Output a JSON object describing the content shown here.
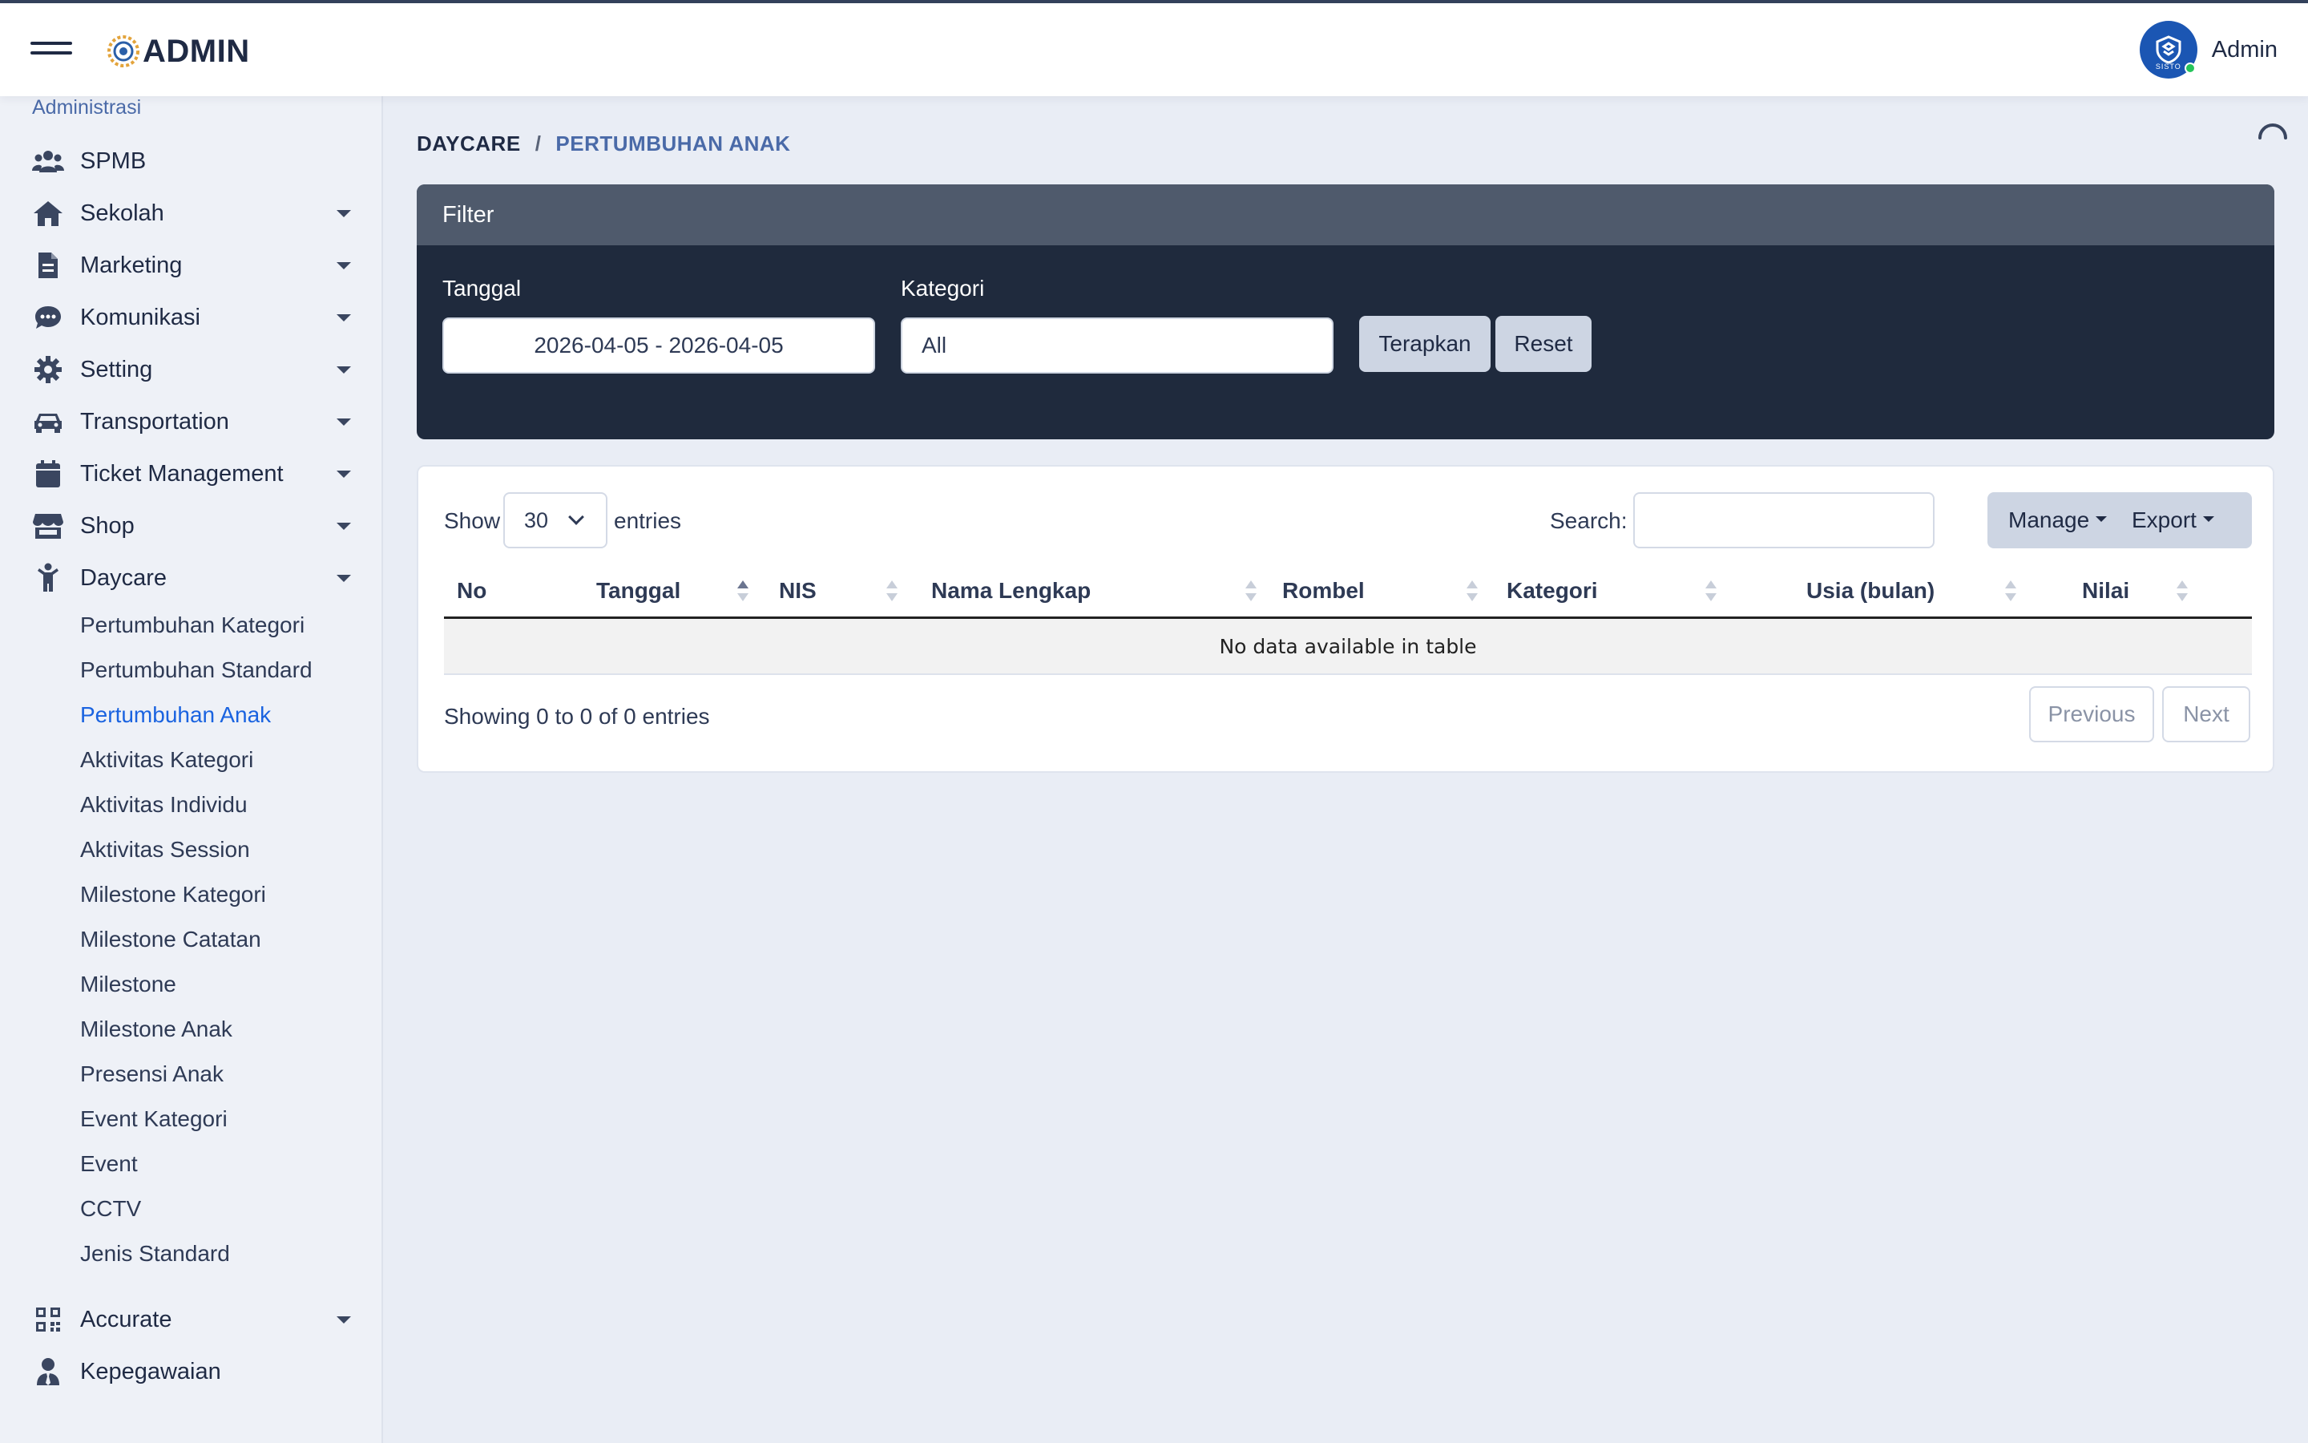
{
  "app": {
    "title": "ADMIN",
    "user_name": "Admin",
    "avatar_text": "SISTO"
  },
  "sidebar": {
    "section_label": "Administrasi",
    "items": [
      {
        "label": "SPMB",
        "icon": "users-icon",
        "has_caret": false
      },
      {
        "label": "Sekolah",
        "icon": "home-icon",
        "has_caret": true
      },
      {
        "label": "Marketing",
        "icon": "document-icon",
        "has_caret": true
      },
      {
        "label": "Komunikasi",
        "icon": "chat-icon",
        "has_caret": true
      },
      {
        "label": "Setting",
        "icon": "gear-icon",
        "has_caret": true
      },
      {
        "label": "Transportation",
        "icon": "car-icon",
        "has_caret": true
      },
      {
        "label": "Ticket Management",
        "icon": "calendar-icon",
        "has_caret": true
      },
      {
        "label": "Shop",
        "icon": "store-icon",
        "has_caret": true
      },
      {
        "label": "Daycare",
        "icon": "child-icon",
        "has_caret": true
      }
    ],
    "daycare_sub": [
      "Pertumbuhan Kategori",
      "Pertumbuhan Standard",
      "Pertumbuhan Anak",
      "Aktivitas Kategori",
      "Aktivitas Individu",
      "Aktivitas Session",
      "Milestone Kategori",
      "Milestone Catatan",
      "Milestone",
      "Milestone Anak",
      "Presensi Anak",
      "Event Kategori",
      "Event",
      "CCTV",
      "Jenis Standard"
    ],
    "active_sub": "Pertumbuhan Anak",
    "bottom_items": [
      {
        "label": "Accurate",
        "icon": "qrcode-icon",
        "has_caret": true
      },
      {
        "label": "Kepegawaian",
        "icon": "user-tie-icon",
        "has_caret": false
      }
    ]
  },
  "breadcrumb": {
    "parent": "DAYCARE",
    "separator": "/",
    "current": "PERTUMBUHAN ANAK"
  },
  "filter": {
    "title": "Filter",
    "tanggal_label": "Tanggal",
    "tanggal_value": "2026-04-05 - 2026-04-05",
    "kategori_label": "Kategori",
    "kategori_value": "All",
    "apply_label": "Terapkan",
    "reset_label": "Reset"
  },
  "table": {
    "show_label": "Show",
    "entries_value": "30",
    "entries_label": "entries",
    "search_label": "Search:",
    "search_value": "",
    "manage_label": "Manage",
    "export_label": "Export",
    "columns": [
      "No",
      "Tanggal",
      "NIS",
      "Nama Lengkap",
      "Rombel",
      "Kategori",
      "Usia (bulan)",
      "Nilai"
    ],
    "sorted_column": "Tanggal",
    "empty_text": "No data available in table",
    "info": "Showing 0 to 0 of 0 entries",
    "prev_label": "Previous",
    "next_label": "Next"
  },
  "colors": {
    "accent": "#1a63e0",
    "filter_bg": "#1f2a3d",
    "filter_header": "#4f5a6c",
    "page_bg": "#e9edf5",
    "button_light": "#cdd5e3"
  }
}
